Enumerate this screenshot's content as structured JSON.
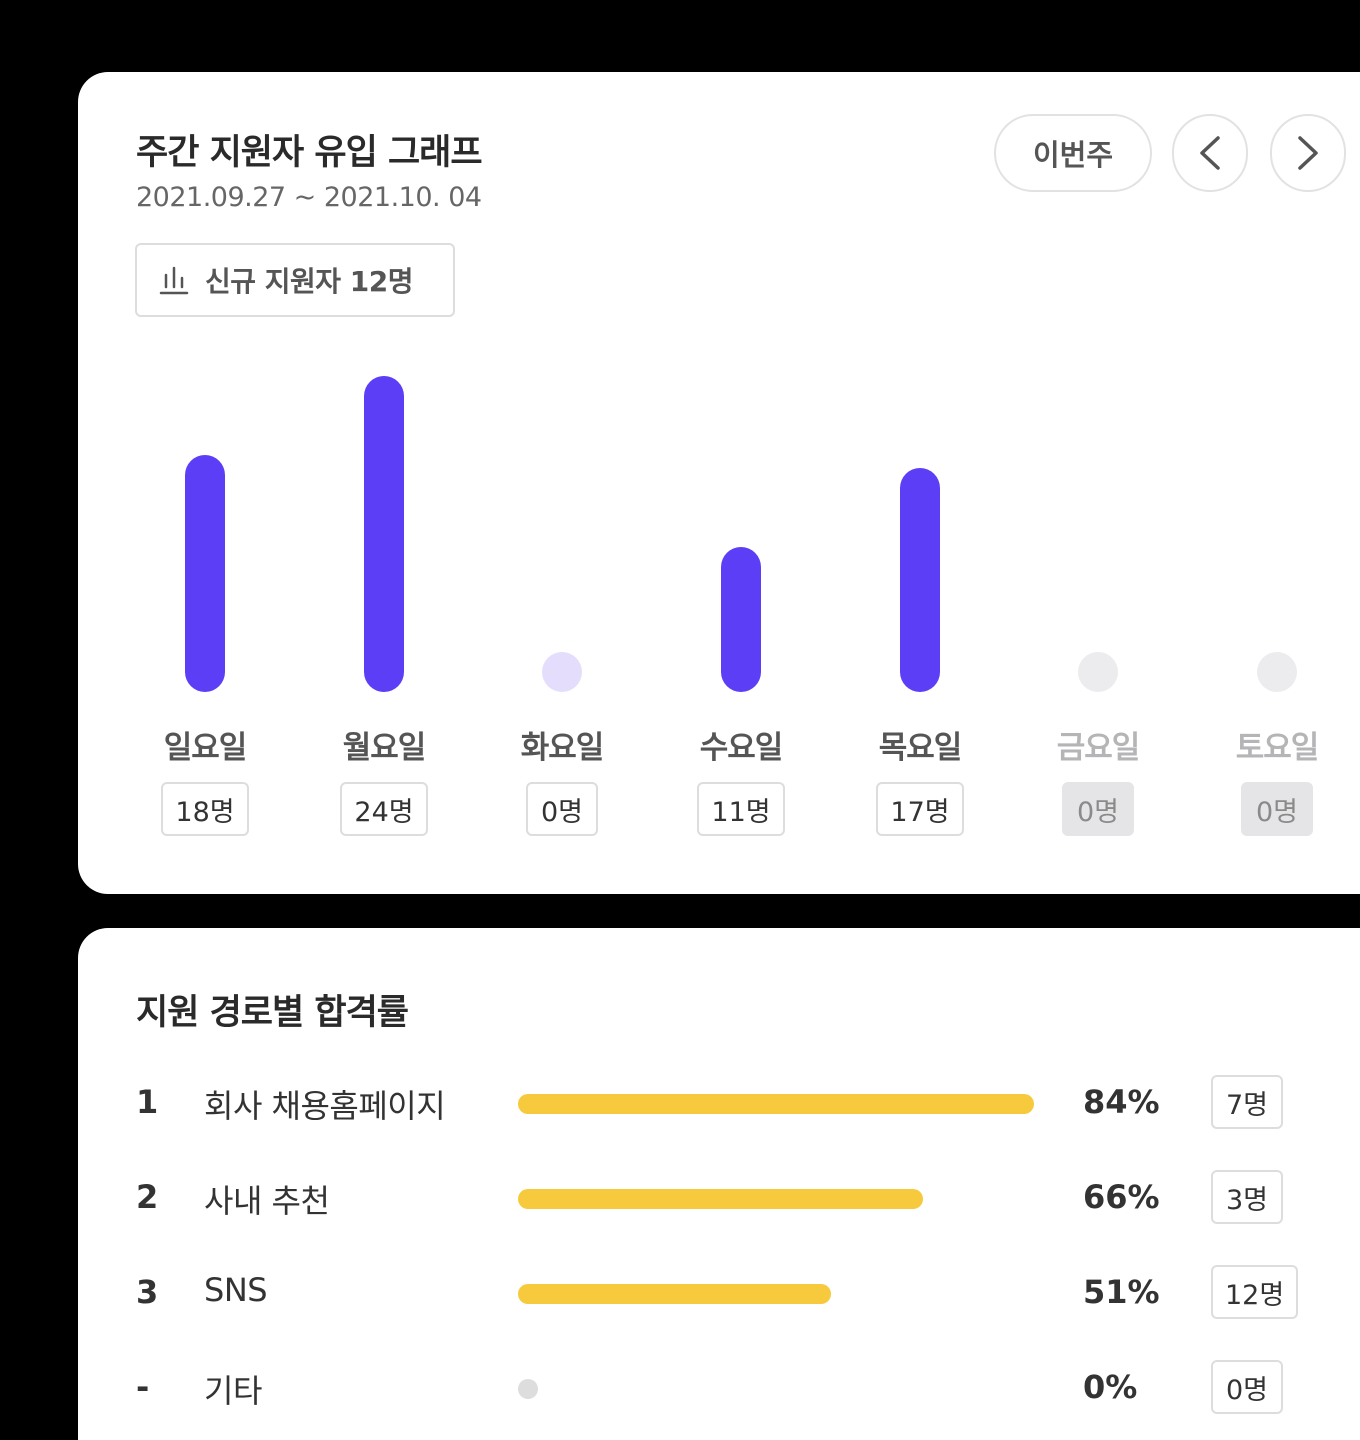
{
  "weekly": {
    "title": "주간 지원자 유입 그래프",
    "date_range": "2021.09.27 ~ 2021.10. 04",
    "this_week_label": "이번주",
    "summary_label": "신규 지원자 12명",
    "colors": {
      "active_bar": "#5b3ef5",
      "zero_active": "#e4defc",
      "zero_future": "#ececee",
      "muted_label": "#b5b5b8"
    }
  },
  "chart_data": {
    "type": "bar",
    "categories": [
      "일요일",
      "월요일",
      "화요일",
      "수요일",
      "목요일",
      "금요일",
      "토요일"
    ],
    "values": [
      18,
      24,
      0,
      11,
      17,
      0,
      0
    ],
    "count_labels": [
      "18명",
      "24명",
      "0명",
      "11명",
      "17명",
      "0명",
      "0명"
    ],
    "future": [
      false,
      false,
      false,
      false,
      false,
      true,
      true
    ],
    "ylim": [
      0,
      24
    ]
  },
  "source": {
    "title": "지원 경로별 합격률",
    "rows": [
      {
        "rank": "1",
        "name": "회사 채용홈페이지",
        "rate": 84,
        "pct_label": "84%",
        "count": "7명"
      },
      {
        "rank": "2",
        "name": "사내 추천",
        "rate": 66,
        "pct_label": "66%",
        "count": "3명"
      },
      {
        "rank": "3",
        "name": "SNS",
        "rate": 51,
        "pct_label": "51%",
        "count": "12명"
      },
      {
        "rank": "-",
        "name": "기타",
        "rate": 0,
        "pct_label": "0%",
        "count": "0명"
      }
    ]
  }
}
